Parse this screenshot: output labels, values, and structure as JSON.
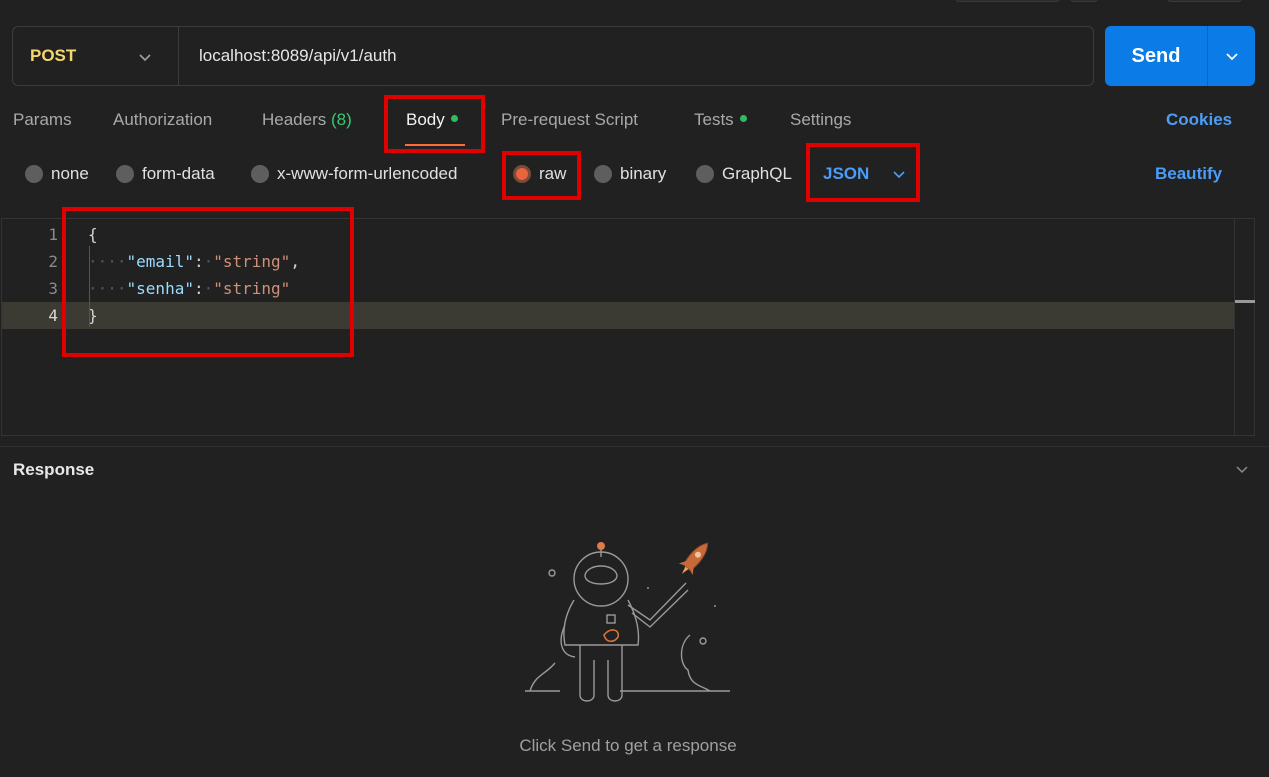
{
  "request": {
    "method": "POST",
    "url": "localhost:8089/api/v1/auth",
    "send_label": "Send"
  },
  "tabs": [
    {
      "label": "Params",
      "active": false
    },
    {
      "label": "Authorization",
      "active": false
    },
    {
      "label": "Headers",
      "count": "(8)",
      "active": false
    },
    {
      "label": "Body",
      "active": true,
      "indicator": true
    },
    {
      "label": "Pre-request Script",
      "active": false
    },
    {
      "label": "Tests",
      "active": false,
      "indicator": true
    },
    {
      "label": "Settings",
      "active": false
    }
  ],
  "cookies_label": "Cookies",
  "body_modes": [
    {
      "label": "none",
      "selected": false
    },
    {
      "label": "form-data",
      "selected": false
    },
    {
      "label": "x-www-form-urlencoded",
      "selected": false
    },
    {
      "label": "raw",
      "selected": true
    },
    {
      "label": "binary",
      "selected": false
    },
    {
      "label": "GraphQL",
      "selected": false
    }
  ],
  "raw_format": "JSON",
  "beautify_label": "Beautify",
  "editor": {
    "line_numbers": [
      "1",
      "2",
      "3",
      "4"
    ],
    "open_brace": "{",
    "close_brace": "}",
    "fields": [
      {
        "key": "\"email\"",
        "value": "\"string\"",
        "trailing": ","
      },
      {
        "key": "\"senha\"",
        "value": "\"string\"",
        "trailing": ""
      }
    ],
    "current_line": 4
  },
  "response": {
    "title": "Response",
    "empty_message": "Click Send to get a response"
  },
  "colors": {
    "method": "#f5d76e",
    "send": "#0b7be8",
    "link": "#4a9df8",
    "highlight_box": "#e00000",
    "active_tab_underline": "#ff6c37",
    "indicator_dot": "#2dbd60"
  },
  "icons": [
    "chevron-down-icon",
    "astronaut-illustration",
    "rocket-icon"
  ]
}
